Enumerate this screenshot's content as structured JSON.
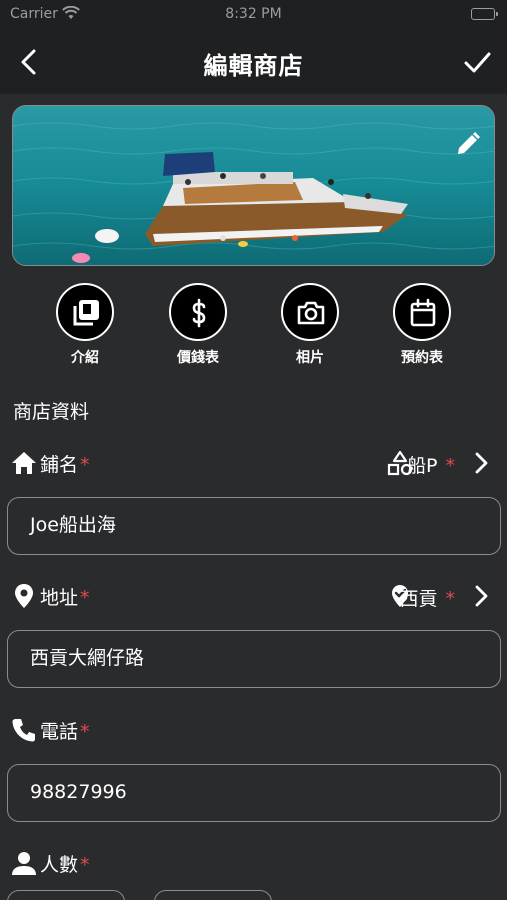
{
  "status_bar": {
    "carrier": "Carrier",
    "time": "8:32 PM"
  },
  "nav": {
    "title": "編輯商店",
    "back_icon": "chevron-left-icon",
    "done_icon": "checkmark-icon"
  },
  "cover": {
    "edit_icon": "pencil-icon"
  },
  "actions": [
    {
      "label": "介紹",
      "icon": "gallery-icon"
    },
    {
      "label": "價錢表",
      "icon": "dollar-icon"
    },
    {
      "label": "相片",
      "icon": "camera-icon"
    },
    {
      "label": "預約表",
      "icon": "calendar-icon"
    }
  ],
  "section_title": "商店資料",
  "fields": {
    "name": {
      "label": "鋪名",
      "required": "*",
      "category": "船P",
      "category_required": "*",
      "value": "Joe船出海"
    },
    "address": {
      "label": "地址",
      "required": "*",
      "district": "西貢",
      "district_required": "*",
      "value": "西貢大網仔路"
    },
    "phone": {
      "label": "電話",
      "required": "*",
      "value": "98827996"
    },
    "people": {
      "label": "人數",
      "required": "*"
    }
  },
  "colors": {
    "background": "#2a2b2d",
    "header": "#1f2022",
    "required": "#e24b4b",
    "border": "#8a8c90"
  }
}
